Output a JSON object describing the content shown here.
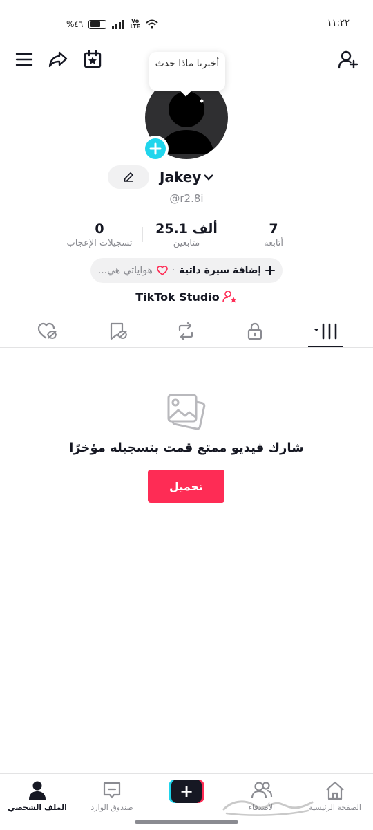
{
  "status_bar": {
    "time": "١١:٢٢",
    "battery": "%٤٦"
  },
  "tooltip": {
    "text": "أخبرنا ماذا حدث"
  },
  "profile": {
    "username": "Jakey",
    "handle": "@r2.8i"
  },
  "stats": [
    {
      "value": "7",
      "label": "أتابعه"
    },
    {
      "value": "25.1 ألف",
      "label": "متابعين"
    },
    {
      "value": "0",
      "label": "تسجيلات الإعجاب"
    }
  ],
  "bio": {
    "add_label": "إضافة سيرة ذاتية",
    "hobbies_label": "هواياتي هي..."
  },
  "studio": {
    "label": "TikTok Studio"
  },
  "tabs": [
    {
      "icon": "videos-grid-icon"
    },
    {
      "icon": "lock-icon"
    },
    {
      "icon": "repost-icon"
    },
    {
      "icon": "saved-icon"
    },
    {
      "icon": "liked-icon"
    }
  ],
  "empty_state": {
    "message": "شارك فيديو ممتع قمت بتسجيله مؤخرًا",
    "upload_label": "تحميل"
  },
  "bottom_nav": {
    "home": "الصفحة الرئيسية",
    "friends": "الأصدقاء",
    "create": "+",
    "inbox": "صندوق الوارد",
    "profile": "الملف الشخصي"
  },
  "colors": {
    "accent": "#fe2c55",
    "cyan": "#20d5ec",
    "text": "#161823",
    "muted": "#8a8b91"
  }
}
